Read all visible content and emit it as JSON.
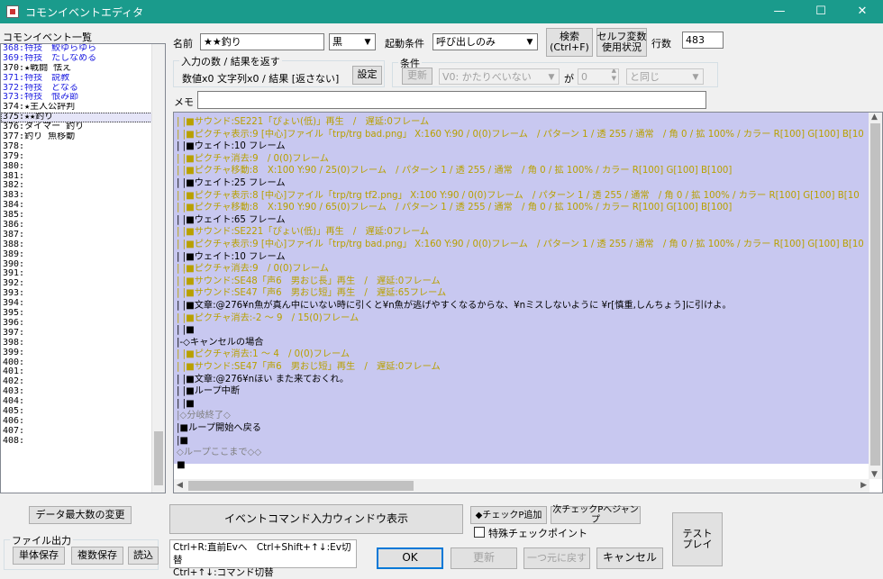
{
  "window": {
    "title": "コモンイベントエディタ",
    "minimize": "—",
    "maximize": "☐",
    "close": "✕"
  },
  "list": {
    "label": "コモンイベント一覧",
    "rows": [
      {
        "text": "368:特技　鮫ゆらゆら",
        "color": "#2020e0"
      },
      {
        "text": "369:特技　たしなめる",
        "color": "#2020e0"
      },
      {
        "text": "370:★戦闘 怯え",
        "color": "#000000"
      },
      {
        "text": "371:特技　説教",
        "color": "#2020e0"
      },
      {
        "text": "372:特技　どなる",
        "color": "#2020e0"
      },
      {
        "text": "373:特技　恨み節",
        "color": "#2020e0"
      },
      {
        "text": "374:★主人公評判",
        "color": "#000000"
      },
      {
        "text": "375:★★釣り",
        "color": "#000000",
        "selected": true
      },
      {
        "text": "376:タイマー 釣り",
        "color": "#000000"
      },
      {
        "text": "377:釣り 魚移動",
        "color": "#000000"
      },
      {
        "text": "378:",
        "color": "#000000"
      },
      {
        "text": "379:",
        "color": "#000000"
      },
      {
        "text": "380:",
        "color": "#000000"
      },
      {
        "text": "381:",
        "color": "#000000"
      },
      {
        "text": "382:",
        "color": "#000000"
      },
      {
        "text": "383:",
        "color": "#000000"
      },
      {
        "text": "384:",
        "color": "#000000"
      },
      {
        "text": "385:",
        "color": "#000000"
      },
      {
        "text": "386:",
        "color": "#000000"
      },
      {
        "text": "387:",
        "color": "#000000"
      },
      {
        "text": "388:",
        "color": "#000000"
      },
      {
        "text": "389:",
        "color": "#000000"
      },
      {
        "text": "390:",
        "color": "#000000"
      },
      {
        "text": "391:",
        "color": "#000000"
      },
      {
        "text": "392:",
        "color": "#000000"
      },
      {
        "text": "393:",
        "color": "#000000"
      },
      {
        "text": "394:",
        "color": "#000000"
      },
      {
        "text": "395:",
        "color": "#000000"
      },
      {
        "text": "396:",
        "color": "#000000"
      },
      {
        "text": "397:",
        "color": "#000000"
      },
      {
        "text": "398:",
        "color": "#000000"
      },
      {
        "text": "399:",
        "color": "#000000"
      },
      {
        "text": "400:",
        "color": "#000000"
      },
      {
        "text": "401:",
        "color": "#000000"
      },
      {
        "text": "402:",
        "color": "#000000"
      },
      {
        "text": "403:",
        "color": "#000000"
      },
      {
        "text": "404:",
        "color": "#000000"
      },
      {
        "text": "405:",
        "color": "#000000"
      },
      {
        "text": "406:",
        "color": "#000000"
      },
      {
        "text": "407:",
        "color": "#000000"
      },
      {
        "text": "408:",
        "color": "#000000"
      }
    ]
  },
  "header": {
    "name_label": "名前",
    "name_value": "★★釣り",
    "color_value": "黒",
    "trigger_label": "起動条件",
    "trigger_value": "呼び出しのみ",
    "search_button": "検索\n(Ctrl+F)",
    "selfvar_button": "セルフ変数\n使用状況",
    "lines_label": "行数",
    "lines_value": "483"
  },
  "io_group": {
    "title": "入力の数 / 結果を返す",
    "summary": "数値x0 文字列x0 / 結果 [返さない]",
    "settings_button": "設定"
  },
  "cond_group": {
    "title": "条件",
    "update_button": "更新",
    "var_value": "V0: かたりべいない",
    "ga_label": "が",
    "num_value": "0",
    "op_value": "と同じ"
  },
  "memo": {
    "label": "メモ",
    "value": ""
  },
  "commands": [
    {
      "text": "|  |■サウンド:SE221「ぴょい(低)」再生　/　遅延:0フレーム",
      "kind": "sound"
    },
    {
      "text": "|  |■ピクチャ表示:9 [中心]ファイル「trp/trg bad.png」 X:160 Y:90 / 0(0)フレーム　/ パターン 1 / 透 255 / 通常　/ 角 0 / 拡 100% / カラー R[100] G[100] B[10",
      "kind": "pic"
    },
    {
      "text": "|  |■ウェイト:10 フレーム",
      "kind": "wait"
    },
    {
      "text": "|  |■ピクチャ消去:9　/ 0(0)フレーム",
      "kind": "pic"
    },
    {
      "text": "|  |■ピクチャ移動:8　X:100 Y:90 / 25(0)フレーム　/ パターン 1 / 透 255 / 通常　/ 角 0 / 拡 100% / カラー R[100] G[100] B[100]",
      "kind": "pic"
    },
    {
      "text": "|  |■ウェイト:25 フレーム",
      "kind": "wait"
    },
    {
      "text": "|  |■ピクチャ表示:8 [中心]ファイル「trp/trg tf2.png」 X:100 Y:90 / 0(0)フレーム　/ パターン 1 / 透 255 / 通常　/ 角 0 / 拡 100% / カラー R[100] G[100] B[10",
      "kind": "pic"
    },
    {
      "text": "|  |■ピクチャ移動:8　X:190 Y:90 / 65(0)フレーム　/ パターン 1 / 透 255 / 通常　/ 角 0 / 拡 100% / カラー R[100] G[100] B[100]",
      "kind": "pic"
    },
    {
      "text": "|  |■ウェイト:65 フレーム",
      "kind": "wait"
    },
    {
      "text": "|  |■サウンド:SE221「ぴょい(低)」再生　/　遅延:0フレーム",
      "kind": "sound"
    },
    {
      "text": "|  |■ピクチャ表示:9 [中心]ファイル「trp/trg bad.png」 X:160 Y:90 / 0(0)フレーム　/ パターン 1 / 透 255 / 通常　/ 角 0 / 拡 100% / カラー R[100] G[100] B[10",
      "kind": "pic"
    },
    {
      "text": "|  |■ウェイト:10 フレーム",
      "kind": "wait"
    },
    {
      "text": "|  |■ピクチャ消去:9　/ 0(0)フレーム",
      "kind": "pic"
    },
    {
      "text": "|  |■サウンド:SE48「声6　男おじ長」再生　/　遅延:0フレーム",
      "kind": "sound"
    },
    {
      "text": "|  |■サウンド:SE47「声6　男おじ短」再生　/　遅延:65フレーム",
      "kind": "sound"
    },
    {
      "text": "|  |■文章:@276¥n魚が真ん中にいない時に引くと¥n魚が逃げやすくなるからな、¥nミスしないように ¥r[慎重,しんちょう]に引けよ。",
      "kind": "text"
    },
    {
      "text": "|  |■ピクチャ消去:-2 ～ 9　/ 15(0)フレーム",
      "kind": "pic"
    },
    {
      "text": "|  |■",
      "kind": "plain"
    },
    {
      "text": "|-◇キャンセルの場合",
      "kind": "plain"
    },
    {
      "text": "|  |■ピクチャ消去:1 ～ 4　/ 0(0)フレーム",
      "kind": "pic"
    },
    {
      "text": "|  |■サウンド:SE47「声6　男おじ短」再生　/　遅延:0フレーム",
      "kind": "sound"
    },
    {
      "text": "|  |■文章:@276¥nほい また来ておくれ。",
      "kind": "text"
    },
    {
      "text": "|  |■ループ中断",
      "kind": "plain"
    },
    {
      "text": "|  |■",
      "kind": "plain"
    },
    {
      "text": "|◇分岐終了◇",
      "kind": "gray"
    },
    {
      "text": "|■ループ開始へ戻る",
      "kind": "plain"
    },
    {
      "text": "|■",
      "kind": "plain"
    },
    {
      "text": "◇ループここまで◇◇",
      "kind": "gray"
    },
    {
      "text": "■",
      "kind": "plain"
    }
  ],
  "bottom": {
    "max_data_button": "データ最大数の変更",
    "file_group_title": "ファイル出力",
    "single_save": "単体保存",
    "multi_save": "複数保存",
    "load": "読込",
    "cmd_window_button": "イベントコマンド入力ウィンドウ表示",
    "add_checkpoint": "◆チェックP追加",
    "next_checkpoint": "次チェックPへジャンプ",
    "special_checkpoint": "特殊チェックポイント",
    "test_play": "テスト\nプレイ",
    "hint_line1": "Ctrl+R:直前Evへ　Ctrl+Shift+↑↓:Ev切替",
    "hint_line2": "Ctrl+↑↓:コマンド切替",
    "ok": "OK",
    "update": "更新",
    "undo": "一つ元に戻す",
    "cancel": "キャンセル"
  }
}
